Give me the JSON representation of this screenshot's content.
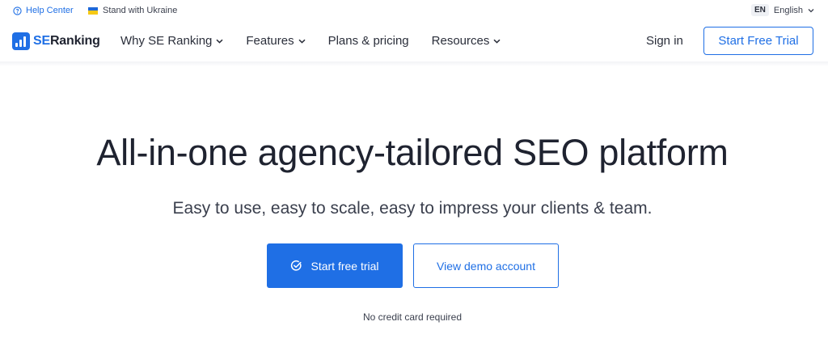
{
  "topbar": {
    "help_label": "Help Center",
    "help_icon": "question-circle-icon",
    "ukraine_label": "Stand with Ukraine",
    "flag_icon": "ukraine-flag-icon",
    "lang_code": "EN",
    "lang_label": "English"
  },
  "nav": {
    "logo_se": "SE",
    "logo_rest": "Ranking",
    "items": [
      {
        "label": "Why SE Ranking",
        "has_dropdown": true
      },
      {
        "label": "Features",
        "has_dropdown": true
      },
      {
        "label": "Plans & pricing",
        "has_dropdown": false
      },
      {
        "label": "Resources",
        "has_dropdown": true
      }
    ],
    "signin_label": "Sign in",
    "trial_label": "Start Free Trial"
  },
  "hero": {
    "title": "All-in-one agency-tailored SEO platform",
    "subtitle": "Easy to use, easy to scale, easy to impress your clients & team.",
    "primary_label": "Start free trial",
    "primary_icon": "check-circle-icon",
    "secondary_label": "View demo account",
    "note": "No credit card required"
  },
  "colors": {
    "accent": "#1f6fe5",
    "text": "#1f2330",
    "flag_blue": "#1f68d6",
    "flag_yellow": "#f6c915"
  }
}
